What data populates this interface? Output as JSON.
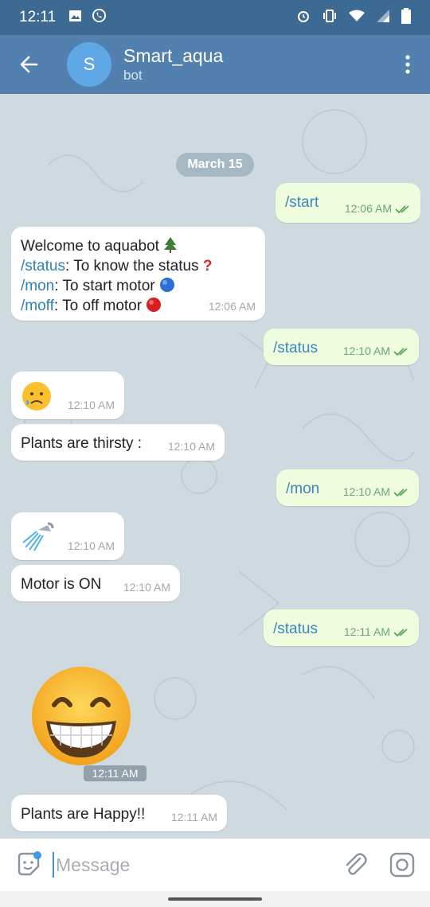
{
  "status_bar": {
    "time": "12:11"
  },
  "header": {
    "title": "Smart_aqua",
    "subtitle": "bot",
    "avatar_letter": "S"
  },
  "chat": {
    "date": "March 15",
    "messages": [
      {
        "dir": "out",
        "text": "/start",
        "time": "12:06 AM"
      },
      {
        "dir": "in",
        "time": "12:06 AM",
        "line1": "Welcome to aquabot",
        "line2_cmd": "/status",
        "line2_rest": ": To know the status",
        "line3_cmd": "/mon",
        "line3_rest": ": To start motor",
        "line4_cmd": "/moff",
        "line4_rest": ": To off motor"
      },
      {
        "dir": "out",
        "text": "/status",
        "time": "12:10 AM"
      },
      {
        "dir": "in",
        "text": "",
        "time": "12:10 AM"
      },
      {
        "dir": "in",
        "text": "Plants are thirsty :",
        "time": "12:10 AM"
      },
      {
        "dir": "out",
        "text": "/mon",
        "time": "12:10 AM"
      },
      {
        "dir": "in",
        "text": "",
        "time": "12:10 AM"
      },
      {
        "dir": "in",
        "text": "Motor is ON",
        "time": "12:10 AM"
      },
      {
        "dir": "out",
        "text": "/status",
        "time": "12:11 AM"
      },
      {
        "dir": "in",
        "text": "",
        "time": "12:11 AM"
      },
      {
        "dir": "in",
        "text": "Plants are Happy!!",
        "time": "12:11 AM"
      }
    ]
  },
  "input": {
    "placeholder": "Message"
  },
  "colors": {
    "header": "#5281b0",
    "status_bar": "#3d6a92",
    "outgoing_bubble": "#effdde",
    "incoming_bubble": "#ffffff",
    "link": "#2f7fb8"
  }
}
